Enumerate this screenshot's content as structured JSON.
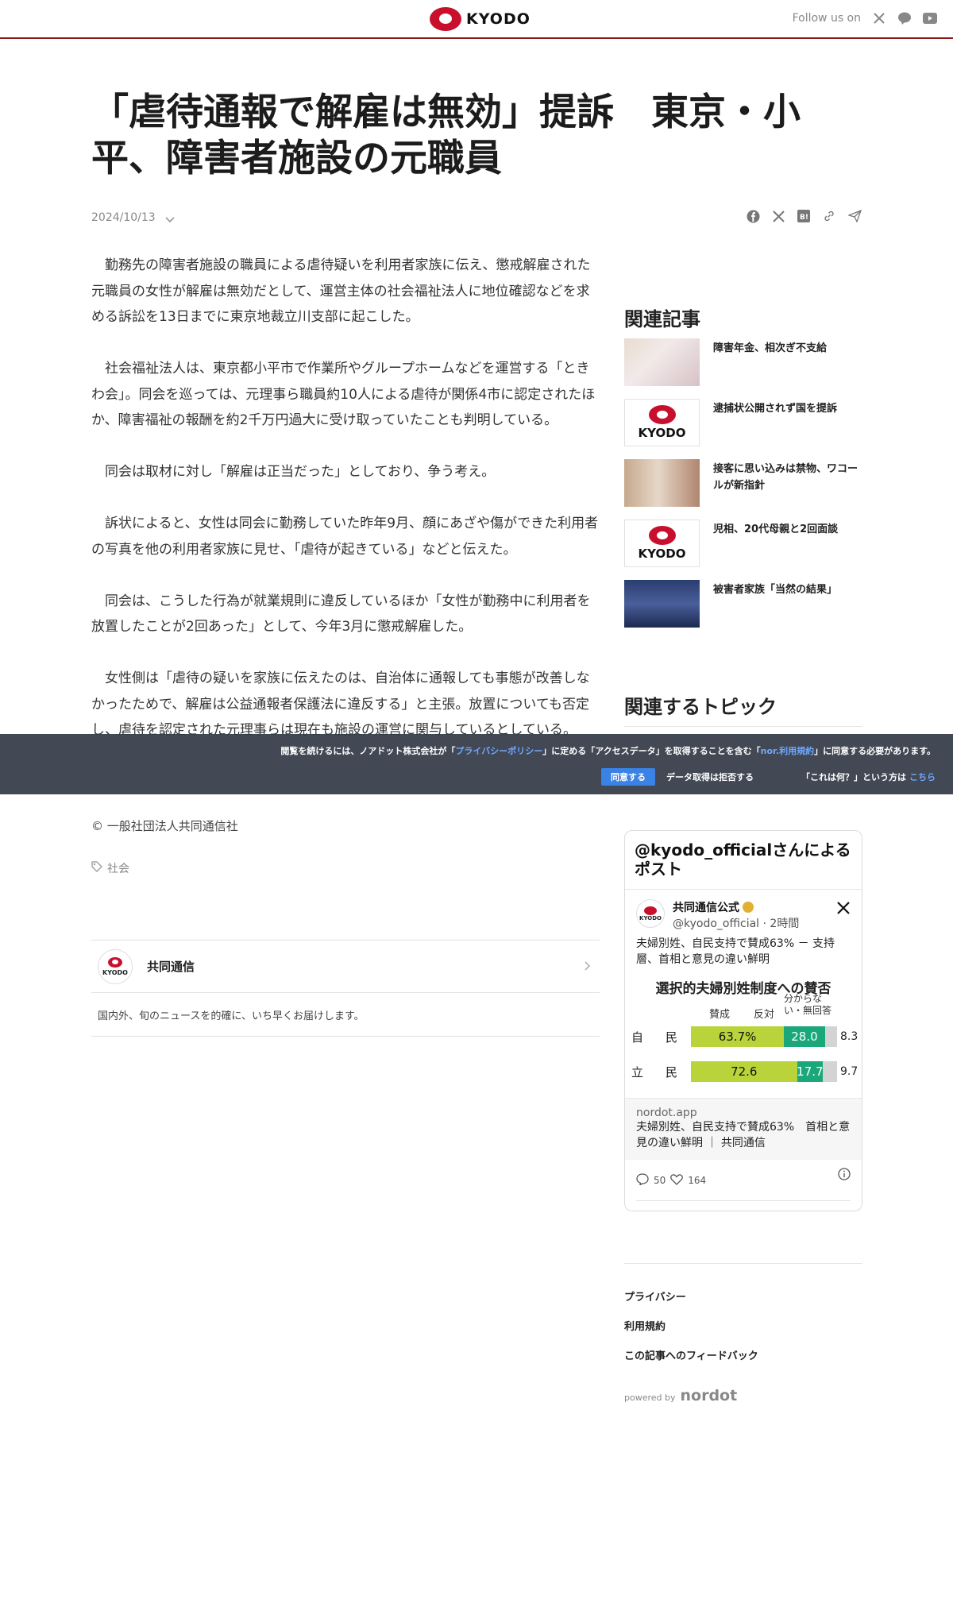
{
  "header": {
    "logo_text": "KYODO",
    "follow_label": "Follow us on",
    "social_icons": [
      "x-icon",
      "line-icon",
      "youtube-icon"
    ]
  },
  "article": {
    "title": "「虐待通報で解雇は無効」提訴　東京・小平、障害者施設の元職員",
    "date": "2024/10/13",
    "share_icons": [
      "facebook-icon",
      "x-icon",
      "hatena-icon",
      "link-icon",
      "send-icon"
    ],
    "paragraphs": [
      "勤務先の障害者施設の職員による虐待疑いを利用者家族に伝え、懲戒解雇された元職員の女性が解雇は無効だとして、運営主体の社会福祉法人に地位確認などを求める訴訟を13日までに東京地裁立川支部に起こした。",
      "社会福祉法人は、東京都小平市で作業所やグループホームなどを運営する「ときわ会」。同会を巡っては、元理事ら職員約10人による虐待が関係4市に認定されたほか、障害福祉の報酬を約2千万円過大に受け取っていたことも判明している。",
      "同会は取材に対し「解雇は正当だった」としており、争う考え。",
      "訴状によると、女性は同会に勤務していた昨年9月、顔にあざや傷ができた利用者の写真を他の利用者家族に見せ、「虐待が起きている」などと伝えた。",
      "同会は、こうした行為が就業規則に違反しているほか「女性が勤務中に利用者を放置したことが2回あった」として、今年3月に懲戒解雇した。",
      "女性側は「虐待の疑いを家族に伝えたのは、自治体に通報しても事態が改善しなかったためで、解雇は公益通報者保護法に違反する」と主張。放置についても否定し、虐待を認定された元理事らは現在も施設の運営に関与しているとしている。"
    ],
    "copyright": "© 一般社団法人共同通信社",
    "tag": "社会"
  },
  "publisher": {
    "logo_text": "KYODO",
    "name": "共同通信",
    "description": "国内外、旬のニュースを的確に、いち早くお届けします。"
  },
  "sidebar": {
    "related_heading": "関連記事",
    "related": [
      {
        "title": "障害年金、相次ぎ不支給",
        "thumb": "photo"
      },
      {
        "title": "逮捕状公開されず国を提訴",
        "thumb": "kyodo"
      },
      {
        "title": "接客に思い込みは禁物、ワコールが新指針",
        "thumb": "photo"
      },
      {
        "title": "児相、20代母親と2回面談",
        "thumb": "kyodo"
      },
      {
        "title": "被害者家族「当然の結果」",
        "thumb": "photo"
      }
    ],
    "topics_heading": "関連するトピック",
    "thumb_logo_text": "KYODO",
    "links": [
      "プライバシー",
      "利用規約",
      "この記事へのフィードバック"
    ],
    "powered_by": "powered by",
    "powered_brand": "nordot"
  },
  "cookie": {
    "text_1": "閲覧を続けるには、ノアドット株式会社が「",
    "privacy_link": "プライバシーポリシー",
    "text_2": "」に定める「アクセスデータ」を取得することを含む「",
    "terms_link": "nor.利用規約",
    "text_3": "」に同意する必要があります。",
    "agree": "同意する",
    "refuse": "データ取得は拒否する",
    "what_text": "「これは何？」という方は",
    "what_link": "こちら"
  },
  "embed": {
    "heading": "@kyodo_officialさんによるポスト",
    "avatar_text": "KYODO",
    "account_name": "共同通信公式",
    "handle": "@kyodo_official · 2時間",
    "text": "夫婦別姓、自民支持で賛成63% － 支持層、首相と意見の違い鮮明",
    "poll_title": "選択的夫婦別姓制度への賛否",
    "label_yes": "賛成",
    "label_no": "反対",
    "label_unk": "分からない・無回答",
    "rows": [
      {
        "party_1": "自",
        "party_2": "民",
        "yes": "63.7%",
        "no": "28.0",
        "unk": "8.3",
        "yes_v": 63.7,
        "no_v": 28.0,
        "unk_v": 8.3
      },
      {
        "party_1": "立",
        "party_2": "民",
        "yes": "72.6",
        "no": "17.7",
        "unk": "9.7",
        "yes_v": 72.6,
        "no_v": 17.7,
        "unk_v": 9.7
      }
    ],
    "card_domain": "nordot.app",
    "card_title": "夫婦別姓、自民支持で賛成63%　首相と意見の違い鮮明 ｜ 共同通信",
    "replies": "50",
    "likes": "164"
  }
}
